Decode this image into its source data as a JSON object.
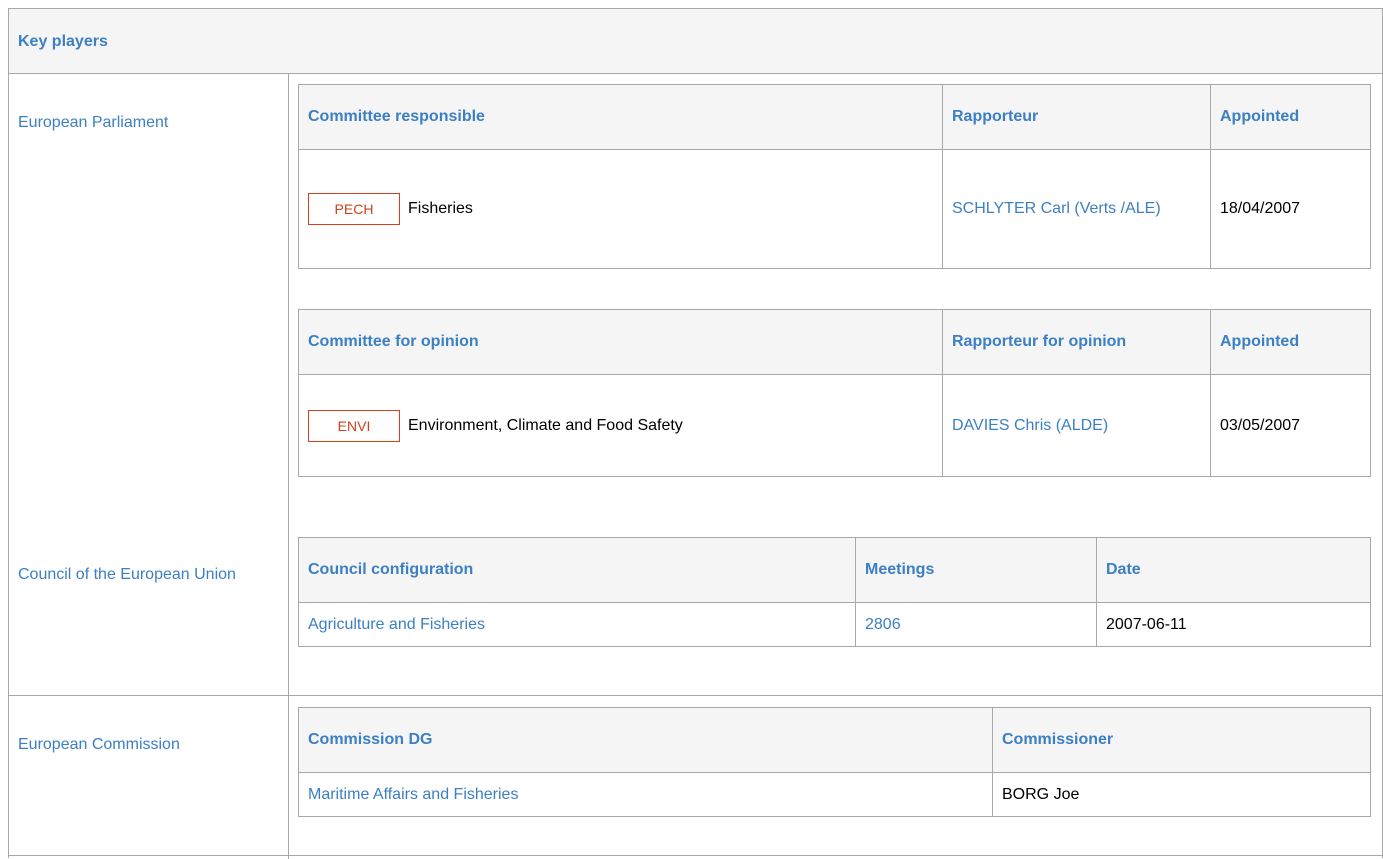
{
  "header": {
    "title": "Key players"
  },
  "european_parliament": {
    "label": "European Parliament",
    "responsible": {
      "columns": [
        "Committee responsible",
        "Rapporteur",
        "Appointed"
      ],
      "row": {
        "code": "PECH",
        "committee": "Fisheries",
        "rapporteur": "SCHLYTER Carl (Verts /ALE)",
        "appointed": "18/04/2007"
      }
    },
    "opinion": {
      "columns": [
        "Committee for opinion",
        "Rapporteur for opinion",
        "Appointed"
      ],
      "row": {
        "code": "ENVI",
        "committee": "Environment, Climate and Food Safety",
        "rapporteur": "DAVIES Chris (ALDE)",
        "appointed": "03/05/2007"
      }
    }
  },
  "council": {
    "label": "Council of the European Union",
    "columns": [
      "Council configuration",
      "Meetings",
      "Date"
    ],
    "row": {
      "configuration": "Agriculture and Fisheries",
      "meetings": "2806",
      "date": "2007-06-11"
    }
  },
  "commission": {
    "label": "European Commission",
    "columns": [
      "Commission DG",
      "Commissioner"
    ],
    "row": {
      "dg": "Maritime Affairs and Fisheries",
      "commissioner": "BORG Joe"
    }
  }
}
